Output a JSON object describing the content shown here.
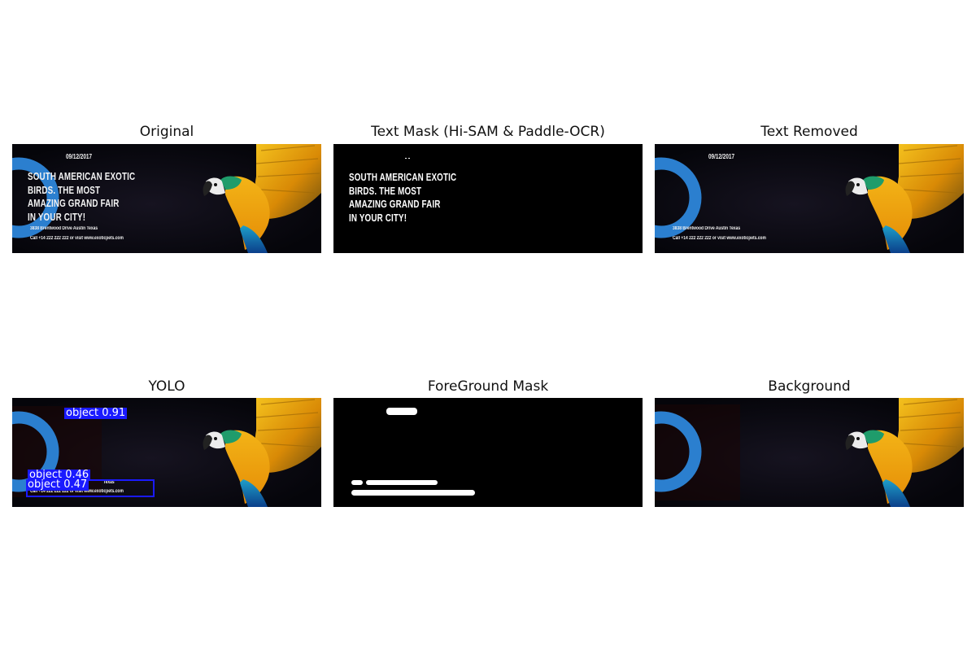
{
  "figure": {
    "panels": [
      {
        "title": "Original"
      },
      {
        "title": "Text Mask (Hi-SAM & Paddle-OCR)"
      },
      {
        "title": "Text Removed"
      },
      {
        "title": "YOLO"
      },
      {
        "title": "ForeGround Mask"
      },
      {
        "title": "Background"
      }
    ]
  },
  "banner": {
    "date": "09/12/2017",
    "date_partial": "09/12/2017",
    "headline": [
      "SOUTH AMERICAN EXOTIC",
      "BIRDS. THE MOST",
      "AMAZING GRAND FAIR",
      "IN YOUR CITY!"
    ],
    "address": "3838 Brentwood Drive Austin Texas",
    "contact": "Call +14 222 222 222 or visit www.exoticpets.com",
    "yolo_fragment": "Texas"
  },
  "detections": [
    {
      "label": "object 0.91",
      "confidence": 0.91
    },
    {
      "label": "object 0.46",
      "confidence": 0.46
    },
    {
      "label": "object 0.47",
      "confidence": 0.47
    }
  ],
  "colors": {
    "banner_bg": "#07070b",
    "ring": "#2b7fcf",
    "detection": "#1a1aff",
    "mask_fg": "#ffffff",
    "mask_bg": "#000000"
  }
}
